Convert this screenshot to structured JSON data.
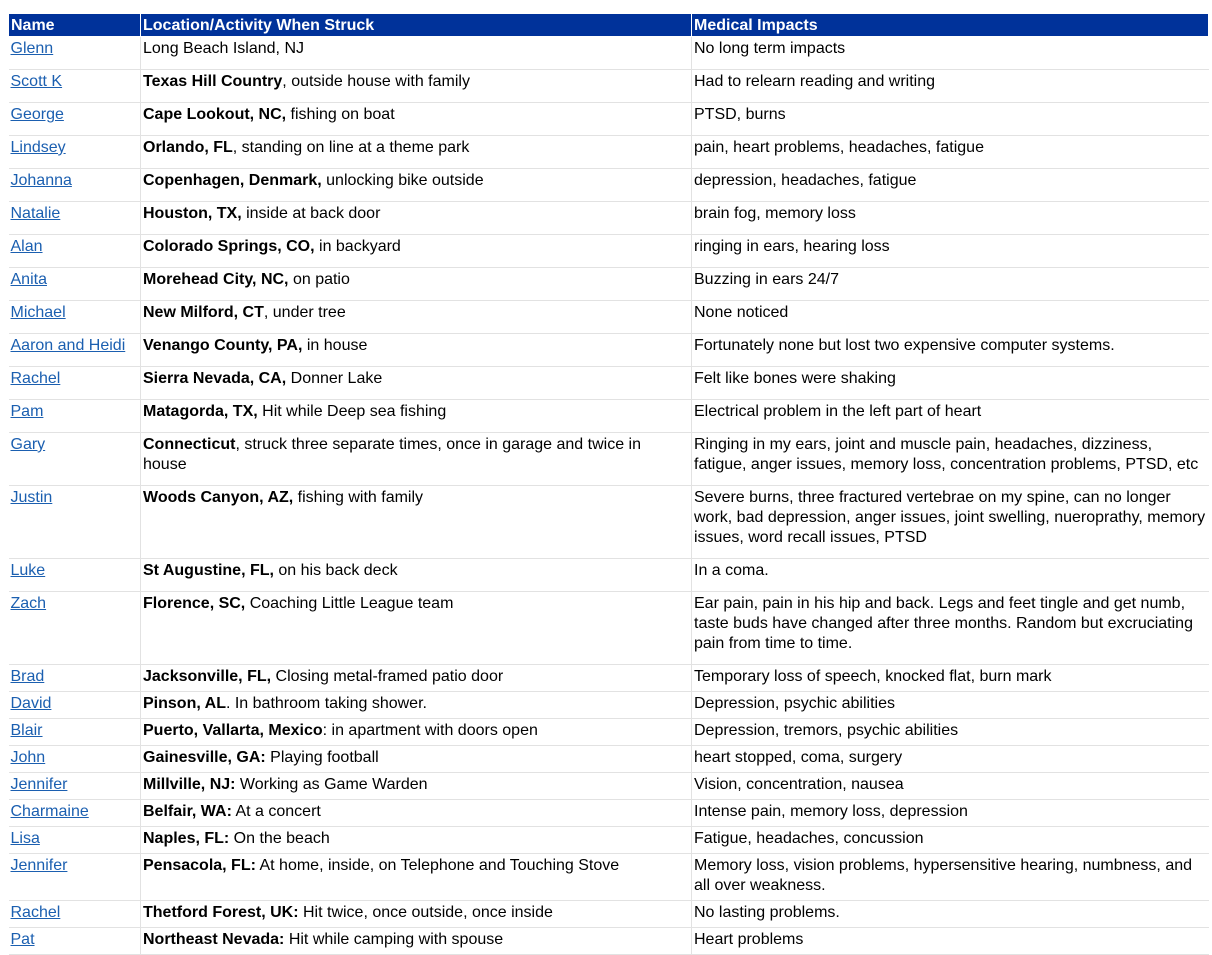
{
  "headers": {
    "name": "Name",
    "location": "Location/Activity When Struck",
    "impacts": "Medical Impacts"
  },
  "rows": [
    {
      "name": "Glenn",
      "loc_bold": "",
      "loc_rest": "Long Beach Island, NJ",
      "impacts": "No long term impacts"
    },
    {
      "name": "Scott K",
      "loc_bold": "Texas Hill Country",
      "loc_rest": ", outside house with family",
      "impacts": "Had to relearn reading and writing"
    },
    {
      "name": "George",
      "loc_bold": "Cape Lookout, NC,",
      "loc_rest": " fishing on boat",
      "impacts": "PTSD, burns"
    },
    {
      "name": "Lindsey",
      "loc_bold": "Orlando, FL",
      "loc_rest": ", standing on line at a theme park",
      "impacts": "pain, heart problems, headaches, fatigue"
    },
    {
      "name": "Johanna",
      "loc_bold": "Copenhagen, Denmark,",
      "loc_rest": " unlocking bike outside",
      "impacts": "depression, headaches, fatigue"
    },
    {
      "name": "Natalie",
      "loc_bold": "Houston, TX,",
      "loc_rest": " inside at back door",
      "impacts": "brain fog, memory loss"
    },
    {
      "name": "Alan",
      "loc_bold": "Colorado Springs, CO,",
      "loc_rest": " in backyard",
      "impacts": "ringing in ears, hearing loss"
    },
    {
      "name": "Anita",
      "loc_bold": "Morehead City, NC,",
      "loc_rest": " on patio",
      "impacts": "Buzzing in ears 24/7"
    },
    {
      "name": "Michael",
      "loc_bold": "New Milford, CT",
      "loc_rest": ", under tree",
      "impacts": "None noticed"
    },
    {
      "name": "Aaron and Heidi",
      "loc_bold": "Venango County, PA,",
      "loc_rest": " in house",
      "impacts": "Fortunately none but lost two expensive computer systems."
    },
    {
      "name": "Rachel",
      "loc_bold": "Sierra Nevada, CA,",
      "loc_rest": " Donner Lake",
      "impacts": "Felt like bones were shaking"
    },
    {
      "name": "Pam",
      "loc_bold": "Matagorda, TX,",
      "loc_rest": " Hit while Deep sea fishing",
      "impacts": "Electrical problem in the left part of heart"
    },
    {
      "name": "Gary",
      "loc_bold": "Connecticut",
      "loc_rest": ", struck three separate times, once in garage and twice in house",
      "impacts": "Ringing in my ears, joint and muscle pain, headaches, dizziness, fatigue, anger issues, memory loss, concentration problems, PTSD, etc"
    },
    {
      "name": "Justin",
      "loc_bold": "Woods Canyon, AZ,",
      "loc_rest": " fishing with family",
      "impacts": "Severe burns, three fractured vertebrae on my spine, can no longer work, bad depression, anger issues, joint swelling, nueroprathy, memory issues, word recall issues, PTSD"
    },
    {
      "name": "Luke",
      "loc_bold": "St Augustine, FL,",
      "loc_rest": " on his back deck",
      "impacts": "In a coma."
    },
    {
      "name": "Zach",
      "loc_bold": "Florence, SC,",
      "loc_rest": " Coaching Little League team",
      "impacts": "Ear pain, pain in his hip and back. Legs and feet tingle and get numb, taste buds have changed after three months. Random but excruciating pain from time to time."
    },
    {
      "name": "Brad",
      "loc_bold": "Jacksonville, FL,",
      "loc_rest": " Closing metal-framed patio door",
      "impacts": "Temporary loss of speech, knocked flat, burn mark"
    },
    {
      "name": "David",
      "loc_bold": "Pinson, AL",
      "loc_rest": ". In bathroom taking shower.",
      "impacts": "Depression, psychic abilities"
    },
    {
      "name": "Blair",
      "loc_bold": "Puerto, Vallarta, Mexico",
      "loc_rest": ": in apartment with doors open",
      "impacts": "Depression, tremors, psychic abilities"
    },
    {
      "name": "John",
      "loc_bold": "Gainesville, GA:",
      "loc_rest": " Playing football",
      "impacts": "heart stopped, coma, surgery"
    },
    {
      "name": "Jennifer",
      "loc_bold": "Millville, NJ:",
      "loc_rest": " Working as Game Warden",
      "impacts": "Vision, concentration, nausea"
    },
    {
      "name": "Charmaine",
      "loc_bold": "Belfair, WA:",
      "loc_rest": " At a concert",
      "impacts": "Intense pain, memory loss, depression"
    },
    {
      "name": "Lisa",
      "loc_bold": "Naples, FL:",
      "loc_rest": " On the beach",
      "impacts": "Fatigue, headaches, concussion"
    },
    {
      "name": "Jennifer",
      "loc_bold": "Pensacola, FL:",
      "loc_rest": " At home, inside, on Telephone and Touching Stove",
      "impacts": "Memory loss, vision problems, hypersensitive hearing, numbness, and all over weakness."
    },
    {
      "name": "Rachel",
      "loc_bold": "Thetford Forest, UK:",
      "loc_rest": " Hit twice, once outside, once inside",
      "impacts": "No lasting problems."
    },
    {
      "name": "Pat",
      "loc_bold": "Northeast Nevada:",
      "loc_rest": " Hit while camping with spouse",
      "impacts": "Heart problems"
    }
  ]
}
